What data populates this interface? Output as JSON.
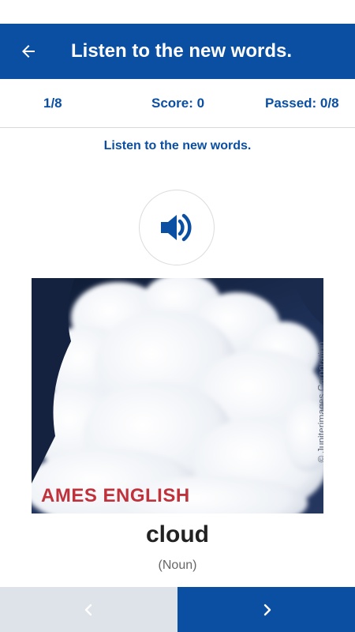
{
  "header": {
    "title": "Listen to the new words.",
    "back_icon": "arrow-left-icon",
    "color": "#0b4fa3"
  },
  "stats": {
    "progress": "1/8",
    "score": "Score: 0",
    "passed": "Passed: 0/8"
  },
  "instruction": "Listen to the new words.",
  "audio": {
    "icon": "speaker-icon"
  },
  "image": {
    "subject": "cloud",
    "watermark": "AMES ENGLISH",
    "credit": "© Jupiterimages Corporation"
  },
  "word": {
    "text": "cloud",
    "part_of_speech": "(Noun)"
  },
  "nav": {
    "prev_icon": "chevron-left-icon",
    "next_icon": "chevron-right-icon"
  }
}
